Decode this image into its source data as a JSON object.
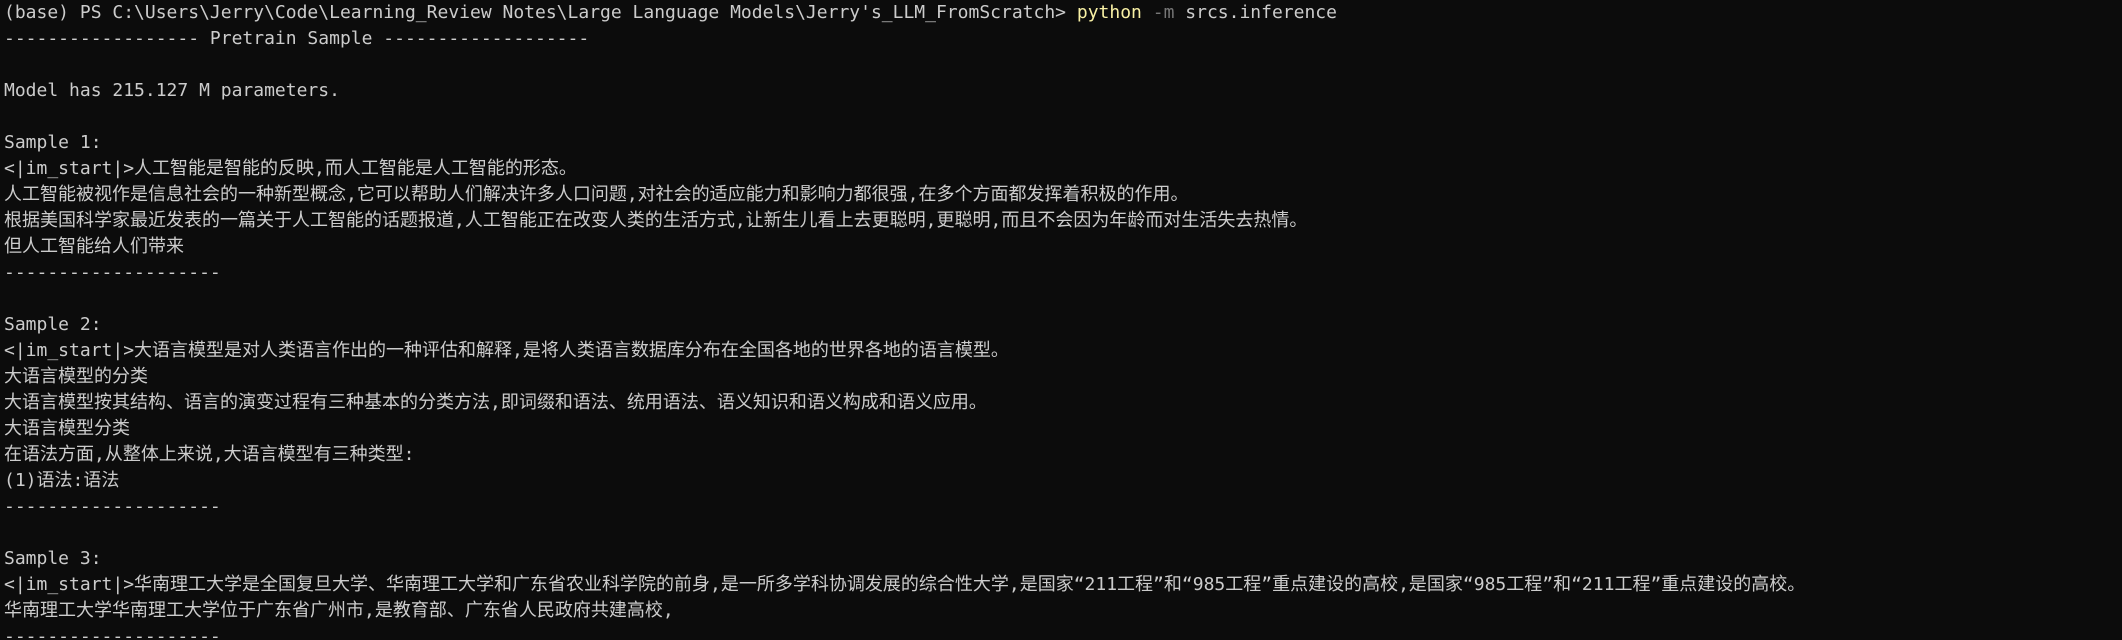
{
  "terminal": {
    "prompt": "(base) PS C:\\Users\\Jerry\\Code\\Learning_Review Notes\\Large Language Models\\Jerry's_LLM_FromScratch> ",
    "command": {
      "executable": "python",
      "flag": "-m",
      "argument": "srcs.inference"
    },
    "lines": [
      "------------------ Pretrain Sample -------------------",
      "",
      "Model has 215.127 M parameters.",
      "",
      "Sample 1:",
      "<|im_start|>人工智能是智能的反映,而人工智能是人工智能的形态。",
      "人工智能被视作是信息社会的一种新型概念,它可以帮助人们解决许多人口问题,对社会的适应能力和影响力都很强,在多个方面都发挥着积极的作用。",
      "根据美国科学家最近发表的一篇关于人工智能的话题报道,人工智能正在改变人类的生活方式,让新生儿看上去更聪明,更聪明,而且不会因为年龄而对生活失去热情。",
      "但人工智能给人们带来",
      "--------------------",
      "",
      "Sample 2:",
      "<|im_start|>大语言模型是对人类语言作出的一种评估和解释,是将人类语言数据库分布在全国各地的世界各地的语言模型。",
      "大语言模型的分类",
      "大语言模型按其结构、语言的演变过程有三种基本的分类方法,即词缀和语法、统用语法、语义知识和语义构成和语义应用。",
      "大语言模型分类",
      "在语法方面,从整体上来说,大语言模型有三种类型:",
      "(1)语法:语法",
      "--------------------",
      "",
      "Sample 3:",
      "<|im_start|>华南理工大学是全国复旦大学、华南理工大学和广东省农业科学院的前身,是一所多学科协调发展的综合性大学,是国家“211工程”和“985工程”重点建设的高校,是国家“985工程”和“211工程”重点建设的高校。",
      "华南理工大学华南理工大学位于广东省广州市,是教育部、广东省人民政府共建高校,",
      "--------------------"
    ]
  },
  "colors": {
    "background": "#0c0c0c",
    "foreground": "#cccccc",
    "command_highlight": "#f9f1a5",
    "flag_dim": "#767676"
  }
}
